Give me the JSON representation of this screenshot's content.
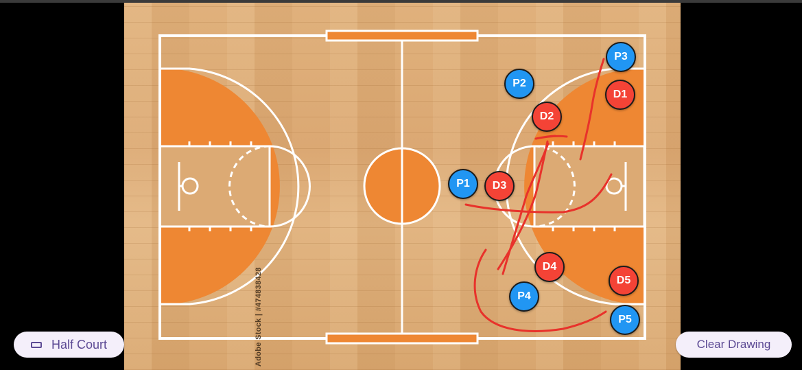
{
  "toolbar": {
    "half_court_label": "Half Court",
    "half_court_icon": "court-outline-icon",
    "clear_drawing_label": "Clear Drawing"
  },
  "court": {
    "watermark": "Adobe Stock | #474838428",
    "line_color": "#ffffff",
    "paint_color": "#ee8733",
    "wood_color": "#dcaa74"
  },
  "players": {
    "offense_color": "#2196f3",
    "defense_color": "#f44336",
    "p1": "P1",
    "p2": "P2",
    "p3": "P3",
    "p4": "P4",
    "p5": "P5",
    "d1": "D1",
    "d2": "D2",
    "d3": "D3",
    "d4": "D4",
    "d5": "D5"
  },
  "drawing": {
    "stroke_color": "#e8322b",
    "stroke_count": 6
  }
}
